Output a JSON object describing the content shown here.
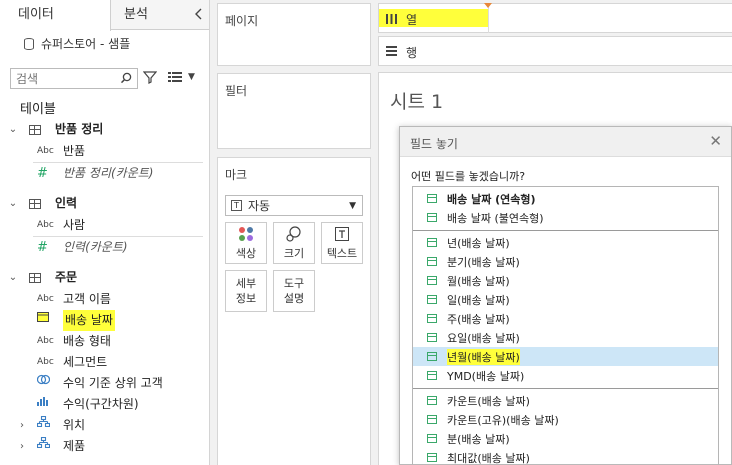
{
  "left_pane": {
    "tabs": [
      "데이터",
      "분석"
    ],
    "datasource": "슈퍼스토어 - 샘플",
    "search_placeholder": "검색",
    "section_title": "테이블",
    "tables": [
      {
        "name": "반품 정리",
        "fields": [
          {
            "type": "abc",
            "label": "반품"
          },
          {
            "type": "measure",
            "label": "반품 정리(카운트)"
          }
        ]
      },
      {
        "name": "인력",
        "fields": [
          {
            "type": "abc",
            "label": "사람"
          },
          {
            "type": "measure",
            "label": "인력(카운트)"
          }
        ]
      },
      {
        "name": "주문",
        "fields": [
          {
            "type": "abc",
            "label": "고객 이름"
          },
          {
            "type": "date",
            "label": "배송 날짜",
            "highlighted": true
          },
          {
            "type": "abc",
            "label": "배송 형태"
          },
          {
            "type": "abc",
            "label": "세그먼트"
          },
          {
            "type": "set",
            "label": "수익 기준 상위 고객"
          },
          {
            "type": "bin",
            "label": "수익(구간차원)"
          },
          {
            "type": "hier",
            "label": "위치",
            "expandable": true
          },
          {
            "type": "hier",
            "label": "제품",
            "expandable": true
          }
        ]
      }
    ]
  },
  "shelves": {
    "pages_title": "페이지",
    "filters_title": "필터",
    "marks_title": "마크",
    "marks_type": "자동",
    "mark_buttons": [
      "색상",
      "크기",
      "텍스트"
    ],
    "mark_buttons_row2": [
      {
        "line1": "세부",
        "line2": "정보"
      },
      {
        "line1": "도구",
        "line2": "설명"
      }
    ],
    "columns_label": "열",
    "rows_label": "행"
  },
  "sheet": {
    "title": "시트 1"
  },
  "dialog": {
    "title": "필드 놓기",
    "question": "어떤 필드를 놓겠습니까?",
    "options_group1": [
      {
        "label": "배송 날짜 (연속형)",
        "bold": true
      },
      {
        "label": "배송 날짜 (불연속형)"
      }
    ],
    "options_group2": [
      {
        "label": "년(배송 날짜)"
      },
      {
        "label": "분기(배송 날짜)"
      },
      {
        "label": "월(배송 날짜)"
      },
      {
        "label": "일(배송 날짜)"
      },
      {
        "label": "주(배송 날짜)"
      },
      {
        "label": "요일(배송 날짜)"
      },
      {
        "label": "년월(배송 날짜)",
        "selected": true
      },
      {
        "label": "YMD(배송 날짜)"
      }
    ],
    "options_group3": [
      {
        "label": "카운트(배송 날짜)"
      },
      {
        "label": "카운트(고유)(배송 날짜)"
      },
      {
        "label": "분(배송 날짜)"
      },
      {
        "label": "최대값(배송 날짜)"
      }
    ]
  },
  "colors": {
    "highlight": "#ffff3b",
    "selection": "#cde6f7",
    "date_icon": "#3aa86a"
  }
}
